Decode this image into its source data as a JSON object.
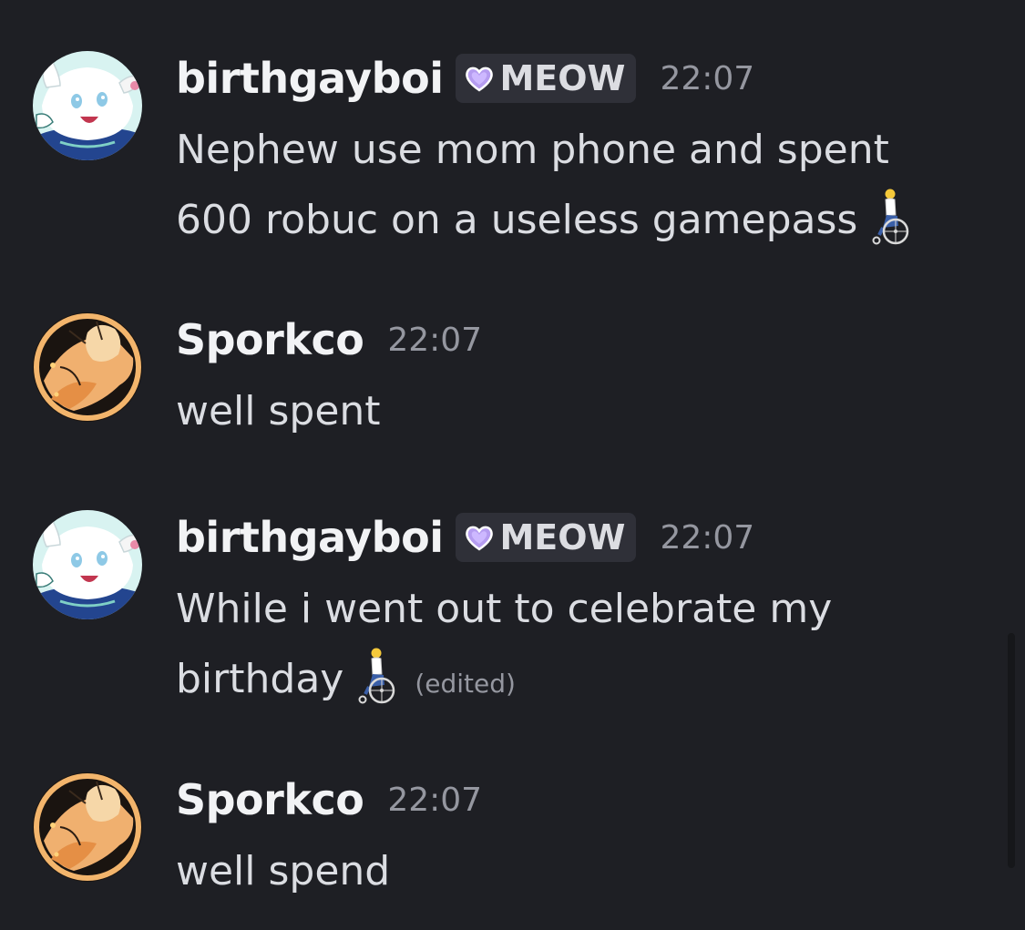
{
  "messages": [
    {
      "author": "birthgayboi",
      "tag": "MEOW",
      "tag_icon": "purple-heart-icon",
      "time": "22:07",
      "text_lines": [
        "Nephew use mom phone and spent",
        "600 robuc on a useless gamepass"
      ],
      "emoji": "person-in-wheelchair-icon",
      "edited": ""
    },
    {
      "author": "Sporkco",
      "time": "22:07",
      "text_lines": [
        "well spent"
      ]
    },
    {
      "author": "birthgayboi",
      "tag": "MEOW",
      "tag_icon": "purple-heart-icon",
      "time": "22:07",
      "text_lines": [
        "While i went out to celebrate my",
        "birthday"
      ],
      "emoji": "person-in-wheelchair-icon",
      "edited": "(edited)"
    },
    {
      "author": "Sporkco",
      "time": "22:07",
      "text_lines": [
        "well spend"
      ]
    }
  ],
  "colors": {
    "background": "#1e1f24",
    "username": "#f2f3f5",
    "message_text": "#dbdde2",
    "timestamp": "#9597a0",
    "tag_background": "#2f3038",
    "tag_heart": "#b59cf0"
  }
}
